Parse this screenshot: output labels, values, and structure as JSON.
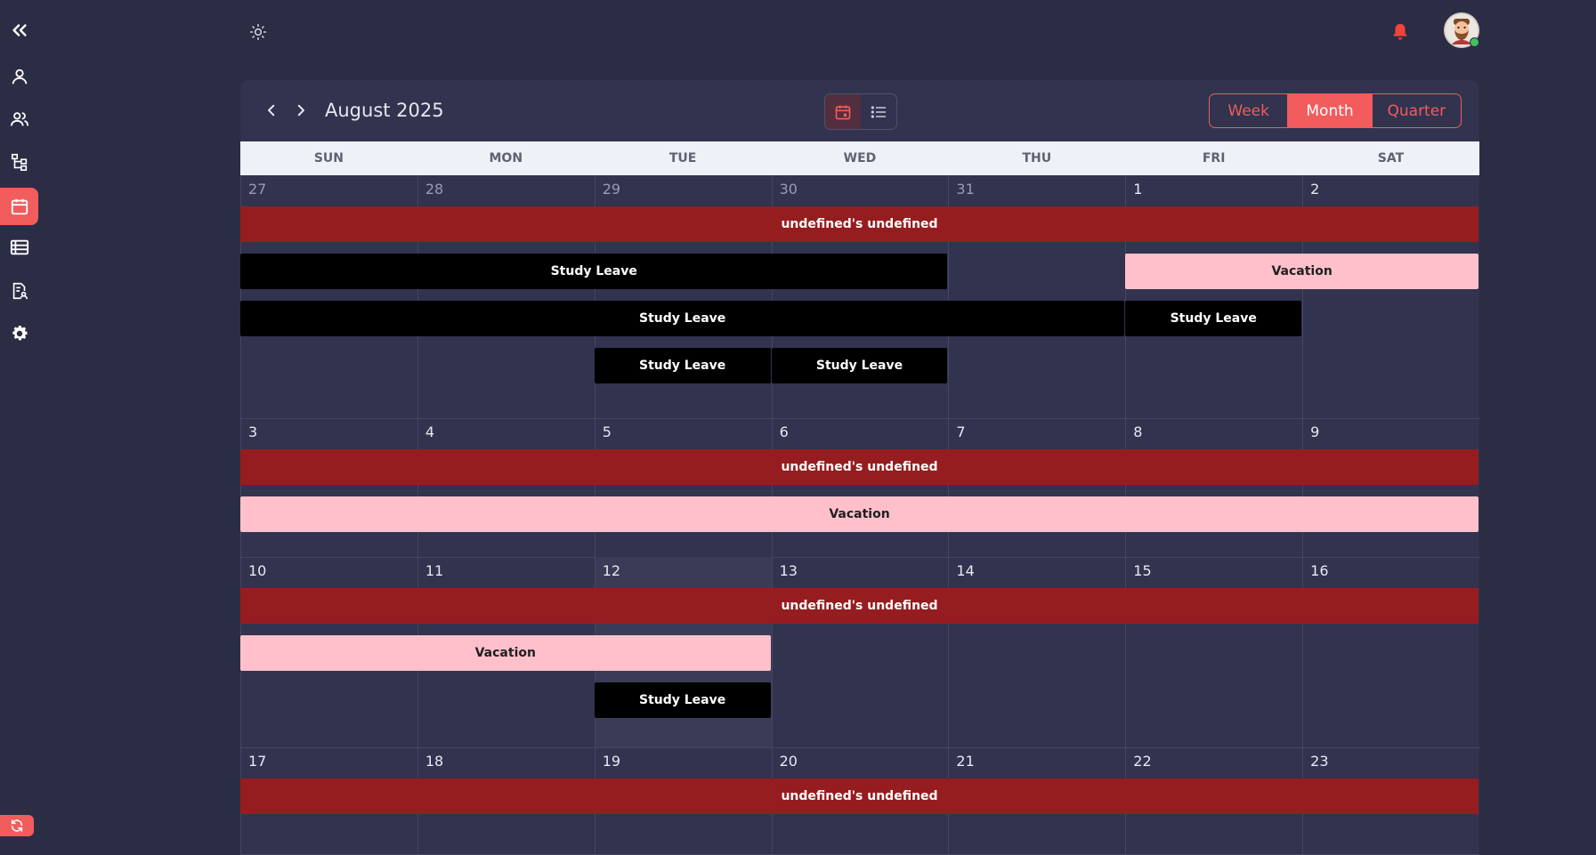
{
  "sidebar": {
    "collapse_icon": "double-chevron-left-icon",
    "items": [
      {
        "name": "profile",
        "icon": "user-icon"
      },
      {
        "name": "team",
        "icon": "users-icon"
      },
      {
        "name": "hierarchy",
        "icon": "org-chart-icon"
      },
      {
        "name": "calendar",
        "icon": "calendar-icon",
        "active": true
      },
      {
        "name": "table",
        "icon": "table-list-icon"
      },
      {
        "name": "reports",
        "icon": "report-user-icon"
      },
      {
        "name": "settings",
        "icon": "gear-icon"
      }
    ],
    "sync_icon": "sync-icon"
  },
  "header": {
    "theme_icon": "sun-icon",
    "bell_icon": "bell-icon",
    "accent_color": "#f25c5c"
  },
  "calendar": {
    "title": "August 2025",
    "view_icons": [
      "calendar-icon",
      "list-icon"
    ],
    "ranges": [
      {
        "label": "Week",
        "active": false
      },
      {
        "label": "Month",
        "active": true
      },
      {
        "label": "Quarter",
        "active": false
      }
    ],
    "days_of_week": [
      "SUN",
      "MON",
      "TUE",
      "WED",
      "THU",
      "FRI",
      "SAT"
    ],
    "weeks": [
      {
        "days": [
          {
            "n": "27",
            "other": true
          },
          {
            "n": "28",
            "other": true
          },
          {
            "n": "29",
            "other": true
          },
          {
            "n": "30",
            "other": true
          },
          {
            "n": "31",
            "other": true
          },
          {
            "n": "1"
          },
          {
            "n": "2"
          }
        ],
        "events": [
          {
            "label": "undefined's undefined",
            "type": "red",
            "start": 0,
            "end": 6,
            "row": 0
          },
          {
            "label": "Study Leave",
            "type": "black",
            "start": 0,
            "end": 3,
            "row": 1
          },
          {
            "label": "Vacation",
            "type": "pink",
            "start": 5,
            "end": 6,
            "row": 1
          },
          {
            "label": "Study Leave",
            "type": "black",
            "start": 0,
            "end": 4,
            "row": 2
          },
          {
            "label": "Study Leave",
            "type": "black",
            "start": 5,
            "end": 5,
            "row": 2
          },
          {
            "label": "Study Leave",
            "type": "black",
            "start": 2,
            "end": 2,
            "row": 3
          },
          {
            "label": "Study Leave",
            "type": "black",
            "start": 3,
            "end": 3,
            "row": 3
          }
        ]
      },
      {
        "days": [
          {
            "n": "3"
          },
          {
            "n": "4"
          },
          {
            "n": "5"
          },
          {
            "n": "6"
          },
          {
            "n": "7"
          },
          {
            "n": "8"
          },
          {
            "n": "9"
          }
        ],
        "events": [
          {
            "label": "undefined's undefined",
            "type": "red",
            "start": 0,
            "end": 6,
            "row": 0
          },
          {
            "label": "Vacation",
            "type": "pink",
            "start": 0,
            "end": 6,
            "row": 1
          }
        ]
      },
      {
        "days": [
          {
            "n": "10"
          },
          {
            "n": "11"
          },
          {
            "n": "12",
            "today": true
          },
          {
            "n": "13"
          },
          {
            "n": "14"
          },
          {
            "n": "15"
          },
          {
            "n": "16"
          }
        ],
        "events": [
          {
            "label": "undefined's undefined",
            "type": "red",
            "start": 0,
            "end": 6,
            "row": 0
          },
          {
            "label": "Vacation",
            "type": "pink",
            "start": 0,
            "end": 2,
            "row": 1
          },
          {
            "label": "Study Leave",
            "type": "black",
            "start": 2,
            "end": 2,
            "row": 2
          }
        ]
      },
      {
        "days": [
          {
            "n": "17"
          },
          {
            "n": "18"
          },
          {
            "n": "19"
          },
          {
            "n": "20"
          },
          {
            "n": "21"
          },
          {
            "n": "22"
          },
          {
            "n": "23"
          }
        ],
        "events": [
          {
            "label": "undefined's undefined",
            "type": "red",
            "start": 0,
            "end": 6,
            "row": 0
          }
        ]
      }
    ]
  }
}
